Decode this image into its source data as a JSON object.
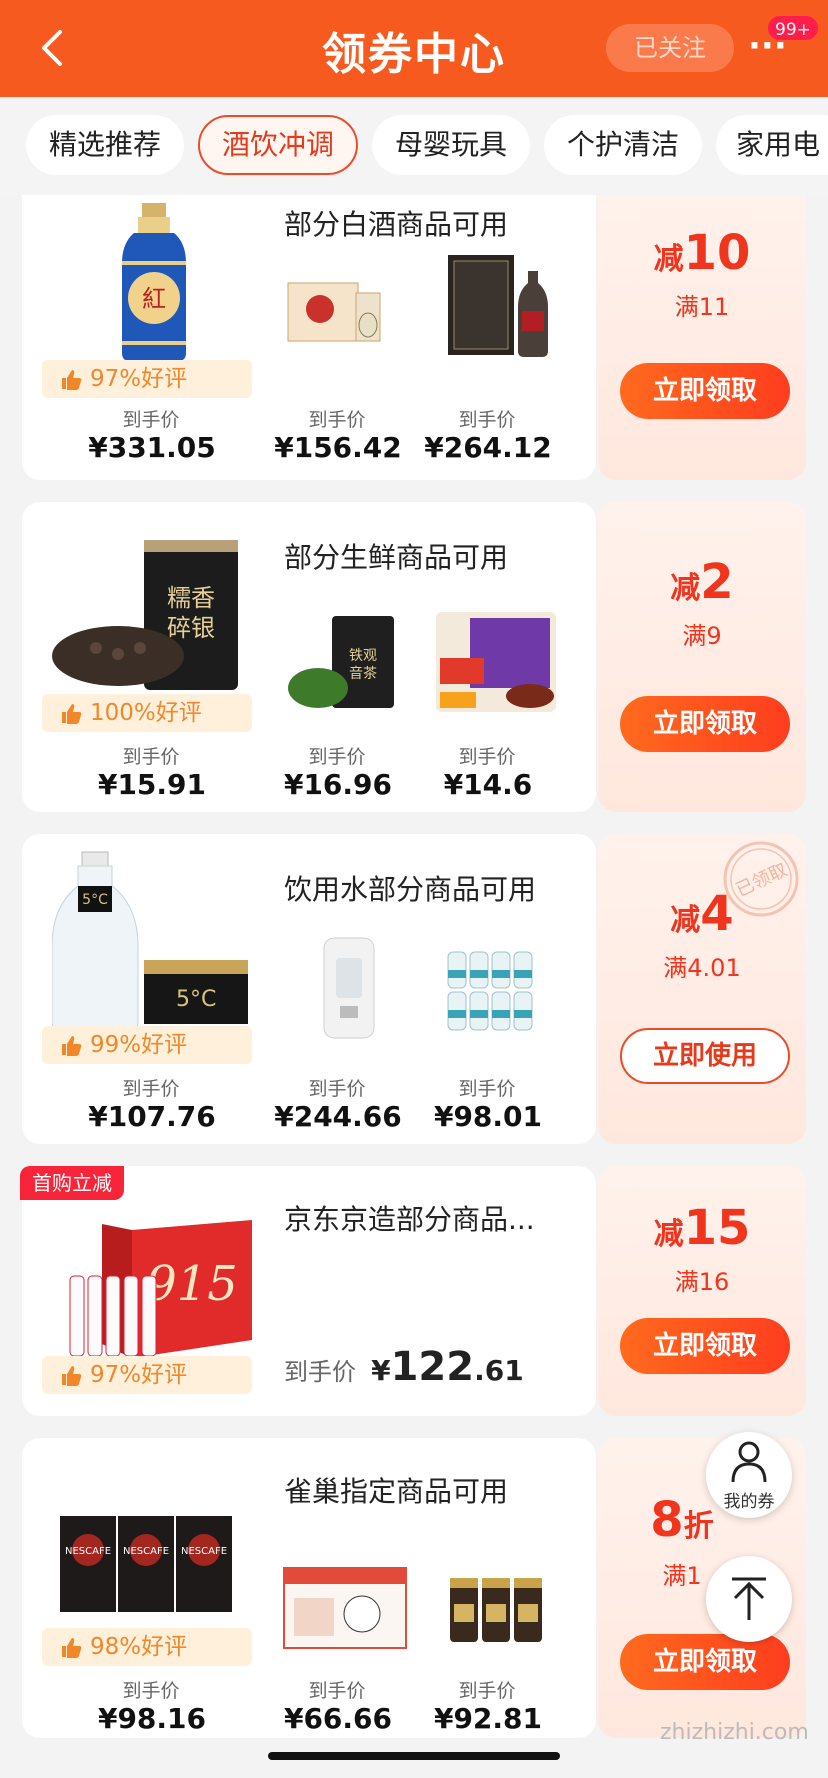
{
  "header": {
    "title": "领券中心",
    "follow_label": "已关注",
    "more_label": "···",
    "badge": "99+"
  },
  "tabs": [
    "精选推荐",
    "酒饮冲调",
    "母婴玩具",
    "个护清洁",
    "家用电"
  ],
  "active_tab": 1,
  "price_label": "到手价",
  "coupons": [
    {
      "title": "部分白酒商品可用",
      "rating": "97%好评",
      "prices": [
        "¥331.05",
        "¥156.42",
        "¥264.12"
      ],
      "discount_prefix": "减",
      "discount_amount": "10",
      "threshold": "满11",
      "button": "立即领取"
    },
    {
      "title": "部分生鲜商品可用",
      "rating": "100%好评",
      "prices": [
        "¥15.91",
        "¥16.96",
        "¥14.6"
      ],
      "discount_prefix": "减",
      "discount_amount": "2",
      "threshold": "满9",
      "button": "立即领取"
    },
    {
      "title": "饮用水部分商品可用",
      "rating": "99%好评",
      "prices": [
        "¥107.76",
        "¥244.66",
        "¥98.01"
      ],
      "discount_prefix": "减",
      "discount_amount": "4",
      "threshold": "满4.01",
      "button": "立即使用",
      "stamp": "已领取"
    },
    {
      "title": "京东京造部分商品...",
      "tag": "首购立减",
      "rating": "97%好评",
      "price_whole": "122",
      "price_frac": ".61",
      "currency": "¥",
      "discount_prefix": "减",
      "discount_amount": "15",
      "threshold": "满16",
      "button": "立即领取"
    },
    {
      "title": "雀巢指定商品可用",
      "rating": "98%好评",
      "prices": [
        "¥98.16",
        "¥66.66",
        "¥92.81"
      ],
      "discount_amount": "8",
      "discount_suffix": "折",
      "threshold": "满1",
      "button": "立即领取"
    }
  ],
  "floating": {
    "my_coupons": "我的券"
  },
  "watermark": "zhizhizhi.com",
  "colors": {
    "brand": "#f75a1e",
    "accent": "#f0351e"
  }
}
